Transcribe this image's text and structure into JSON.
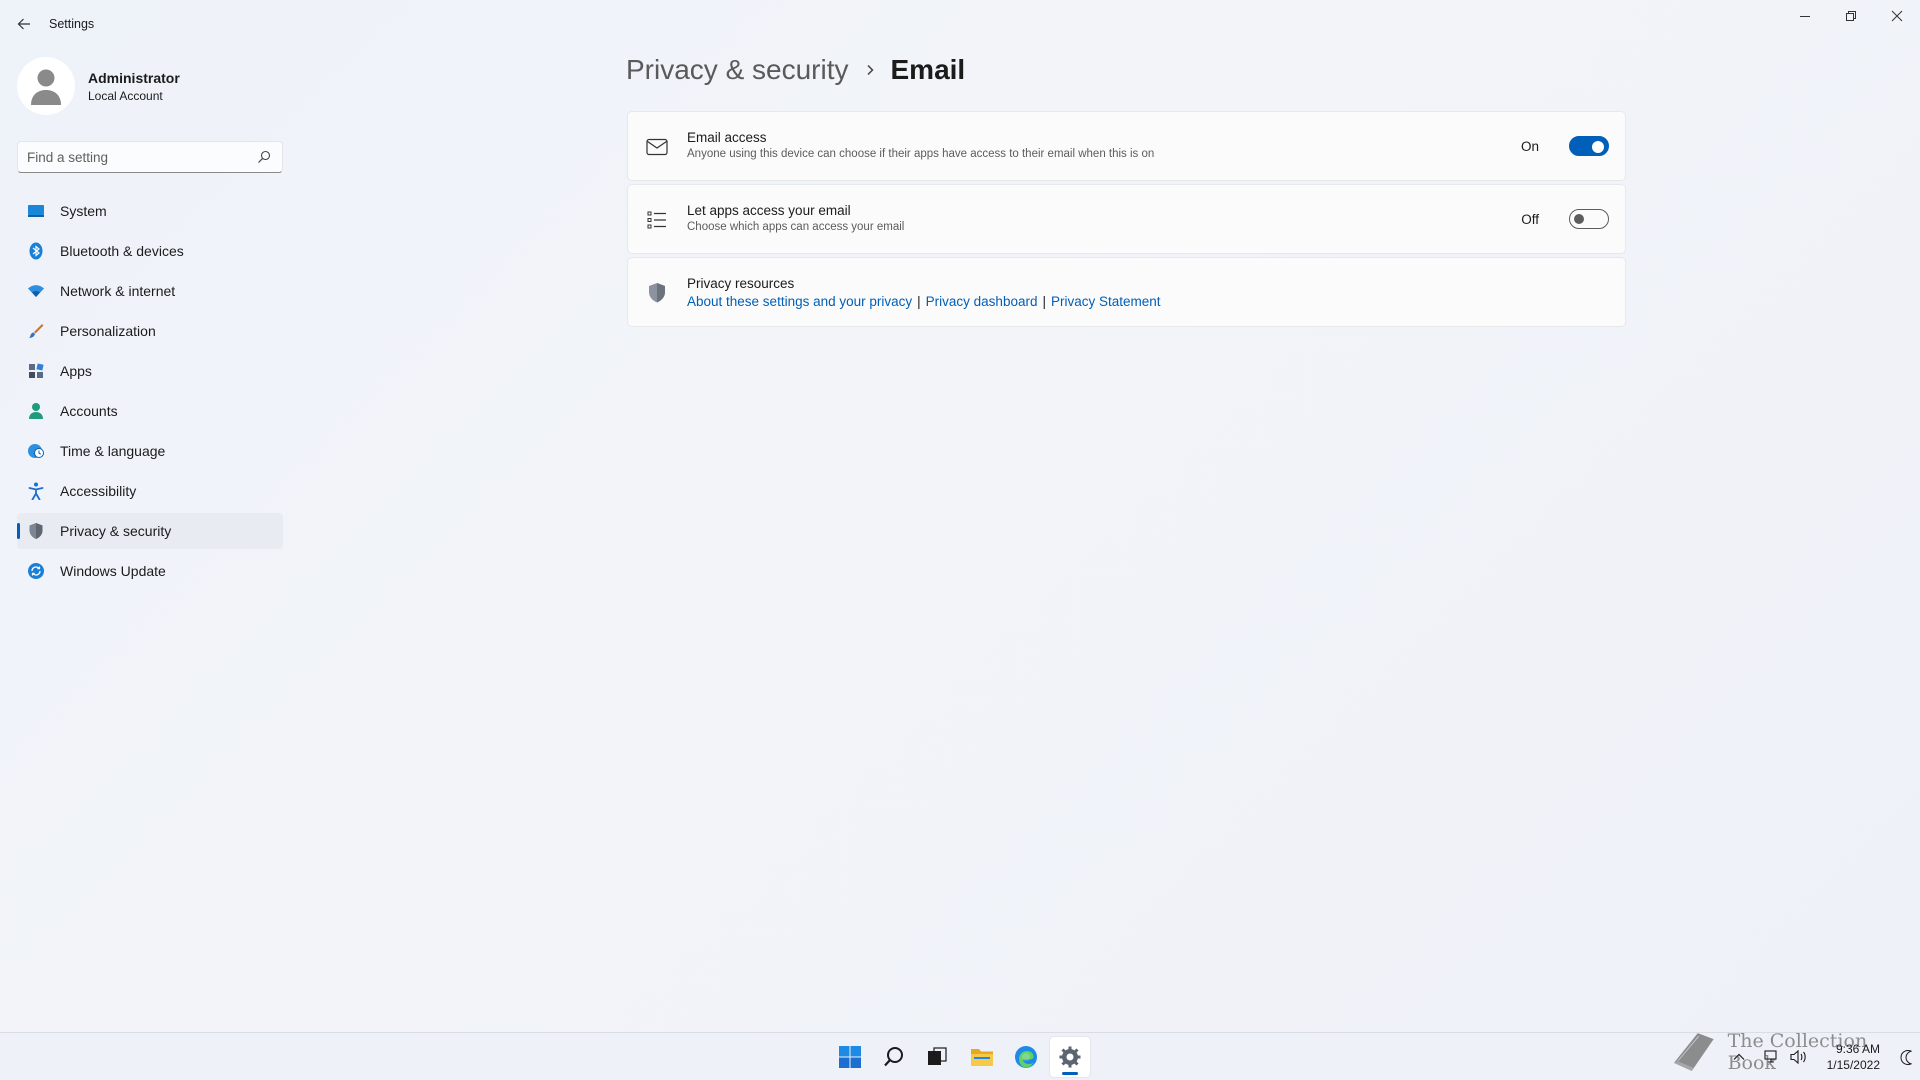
{
  "window": {
    "title": "Settings"
  },
  "profile": {
    "name": "Administrator",
    "account_type": "Local Account"
  },
  "search": {
    "placeholder": "Find a setting"
  },
  "sidebar": {
    "items": [
      {
        "label": "System",
        "icon": "system-icon",
        "active": false
      },
      {
        "label": "Bluetooth & devices",
        "icon": "bluetooth-icon",
        "active": false
      },
      {
        "label": "Network & internet",
        "icon": "wifi-icon",
        "active": false
      },
      {
        "label": "Personalization",
        "icon": "brush-icon",
        "active": false
      },
      {
        "label": "Apps",
        "icon": "apps-icon",
        "active": false
      },
      {
        "label": "Accounts",
        "icon": "person-icon",
        "active": false
      },
      {
        "label": "Time & language",
        "icon": "globe-clock-icon",
        "active": false
      },
      {
        "label": "Accessibility",
        "icon": "accessibility-icon",
        "active": false
      },
      {
        "label": "Privacy & security",
        "icon": "shield-icon",
        "active": true
      },
      {
        "label": "Windows Update",
        "icon": "update-icon",
        "active": false
      }
    ]
  },
  "breadcrumb": {
    "parent": "Privacy & security",
    "current": "Email"
  },
  "settings": {
    "email_access": {
      "title": "Email access",
      "description": "Anyone using this device can choose if their apps have access to their email when this is on",
      "state_label": "On",
      "enabled": true
    },
    "apps_access": {
      "title": "Let apps access your email",
      "description": "Choose which apps can access your email",
      "state_label": "Off",
      "enabled": false
    },
    "privacy_resources": {
      "title": "Privacy resources",
      "links": [
        "About these settings and your privacy",
        "Privacy dashboard",
        "Privacy Statement"
      ],
      "separator": "|"
    }
  },
  "taskbar": {
    "apps": [
      "start-icon",
      "search-icon",
      "task-view-icon",
      "file-explorer-icon",
      "edge-icon",
      "settings-icon"
    ],
    "active_app": "settings-icon",
    "time": "9:36 AM",
    "date": "1/15/2022"
  },
  "watermark": {
    "text": "The Collection Book"
  },
  "colors": {
    "accent": "#005fb8",
    "background": "#eff2f8",
    "card": "#fbfbfc"
  }
}
